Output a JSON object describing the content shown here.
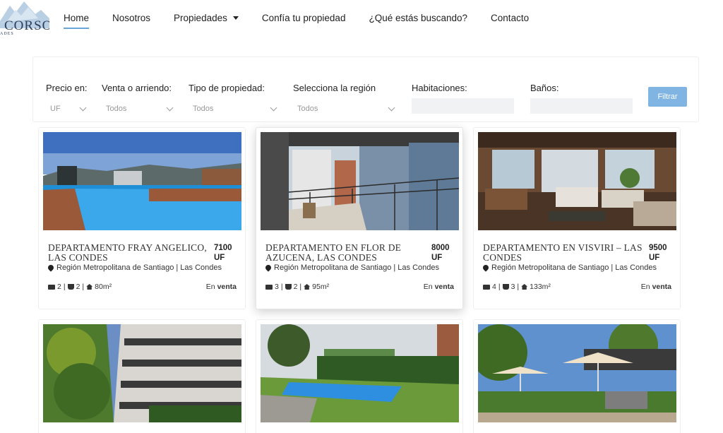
{
  "brand": {
    "name": "CORSO",
    "tagline": "ADES"
  },
  "nav": {
    "items": [
      {
        "label": "Home",
        "active": true
      },
      {
        "label": "Nosotros"
      },
      {
        "label": "Propiedades",
        "dropdown": true
      },
      {
        "label": "Confía tu propiedad"
      },
      {
        "label": "¿Qué estás buscando?"
      },
      {
        "label": "Contacto"
      }
    ]
  },
  "filters": {
    "precio": {
      "label": "Precio en:",
      "value": "UF"
    },
    "operacion": {
      "label": "Venta o arriendo:",
      "value": "Todos"
    },
    "tipo": {
      "label": "Tipo de propiedad:",
      "value": "Todos"
    },
    "region": {
      "label": "Selecciona la región",
      "value": "Todos"
    },
    "habitaciones": {
      "label": "Habitaciones:",
      "value": ""
    },
    "banos": {
      "label": "Baños:",
      "value": ""
    },
    "submit_label": "Filtrar"
  },
  "listings": [
    {
      "title": "DEPARTAMENTO FRAY ANGELICO, LAS CONDES",
      "price": "7100 UF",
      "location": "Región Metropolitana de Santiago | Las Condes",
      "bedrooms": "2",
      "bathrooms": "2",
      "area": "80m²",
      "operation_prefix": "En",
      "operation": "venta",
      "photo": "rooftop-pool-photo"
    },
    {
      "title": "DEPARTAMENTO EN FLOR DE AZUCENA, LAS CONDES",
      "price": "8000 UF",
      "location": "Región Metropolitana de Santiago | Las Condes",
      "bedrooms": "3",
      "bathrooms": "2",
      "area": "95m²",
      "operation_prefix": "En",
      "operation": "venta",
      "photo": "balcony-city-view-photo"
    },
    {
      "title": "DEPARTAMENTO EN VISVIRI – LAS CONDES",
      "price": "9500 UF",
      "location": "Región Metropolitana de Santiago | Las Condes",
      "bedrooms": "4",
      "bathrooms": "3",
      "area": "133m²",
      "operation_prefix": "En",
      "operation": "venta",
      "photo": "living-room-photo"
    },
    {
      "photo": "building-facade-photo"
    },
    {
      "photo": "garden-pool-photo"
    },
    {
      "photo": "patio-umbrellas-photo"
    }
  ],
  "colors": {
    "accent": "#6aa7d9",
    "button": "#7fb4e3",
    "input_bg": "#f0f2f4"
  }
}
